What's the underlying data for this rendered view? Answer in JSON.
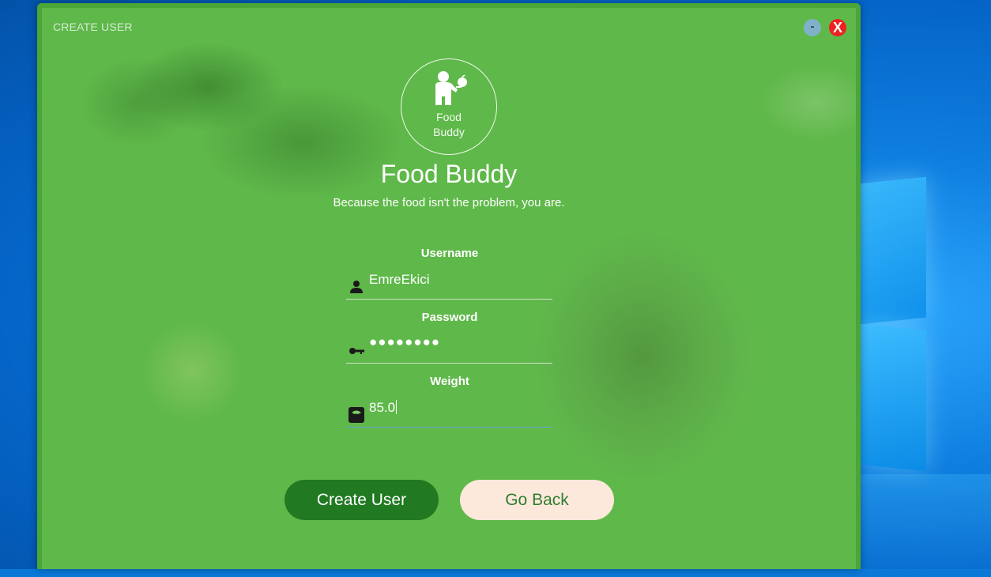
{
  "window": {
    "title": "CREATE USER",
    "minimize_label": "-",
    "close_label": "X"
  },
  "logo": {
    "line1": "Food",
    "line2": "Buddy"
  },
  "header": {
    "title": "Food Buddy",
    "tagline": "Because the food isn't the problem, you are."
  },
  "form": {
    "username": {
      "label": "Username",
      "value": "EmreEkici",
      "icon": "user-icon"
    },
    "password": {
      "label": "Password",
      "value": "●●●●●●●●",
      "icon": "key-icon"
    },
    "weight": {
      "label": "Weight",
      "value": "85.0",
      "icon": "scale-icon"
    }
  },
  "buttons": {
    "create": "Create User",
    "back": "Go Back"
  },
  "colors": {
    "app_green": "#5fb84a",
    "create_button": "#217a22",
    "back_button": "#fde9dc",
    "close_red": "#f02020"
  }
}
